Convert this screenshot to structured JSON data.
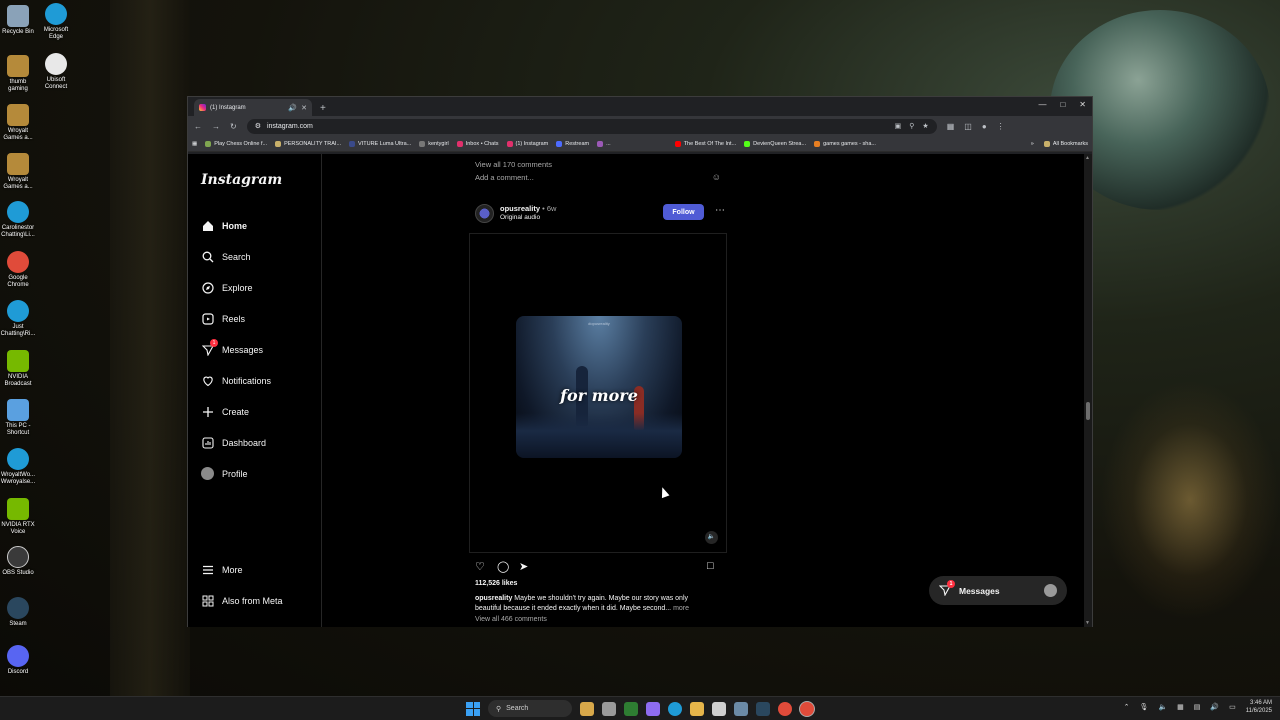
{
  "desktop": {
    "icons": [
      {
        "label": "Recycle Bin",
        "color": "#8aa2b8"
      },
      {
        "label": "Microsoft Edge",
        "color": "#1f9bd6"
      },
      {
        "label": "thumb gaming",
        "color": "#b58a3a"
      },
      {
        "label": "Ubisoft Connect",
        "color": "#e8e8e8"
      },
      {
        "label": "Wroyalt Games a...",
        "color": "#b58a3a"
      },
      {
        "label": "Wroyalt Games a...",
        "color": "#b58a3a"
      },
      {
        "label": "Carolinestor Chatting\\Li...",
        "color": "#1f9bd6"
      },
      {
        "label": "Google Chrome",
        "color": "#e04b3a"
      },
      {
        "label": "Just Chatting\\Ri...",
        "color": "#1f9bd6"
      },
      {
        "label": "NVIDIA Broadcast",
        "color": "#76b900"
      },
      {
        "label": "This PC - Shortcut",
        "color": "#5aa0e0"
      },
      {
        "label": "WroyaltWo... Wwroyalse...",
        "color": "#1f9bd6"
      },
      {
        "label": "NVIDIA RTX Voice",
        "color": "#76b900"
      },
      {
        "label": "OBS Studio",
        "color": "#3a3a3a"
      },
      {
        "label": "Steam",
        "color": "#2a475e"
      },
      {
        "label": "Discord",
        "color": "#5865f2"
      }
    ]
  },
  "browser": {
    "tab_title": "(1) Instagram",
    "new_tab": "+",
    "url": "instagram.com",
    "bookmarks": [
      {
        "label": "Play Chess Online f...",
        "color": "#7fa650"
      },
      {
        "label": "PERSONALITY TRAI...",
        "color": "#c8b06a"
      },
      {
        "label": "VITURE Luma Ultra...",
        "color": "#3a4a8a"
      },
      {
        "label": "kentygirl",
        "color": "#777777"
      },
      {
        "label": "Inbox • Chats",
        "color": "#e1306c"
      },
      {
        "label": "(1) Instagram",
        "color": "#e1306c"
      },
      {
        "label": "Restream",
        "color": "#4d6bfe"
      },
      {
        "label": "...",
        "color": "#9b59b6"
      },
      {
        "label": "The Best Of The Int...",
        "color": "#ff0000"
      },
      {
        "label": "DevienQueen Strea...",
        "color": "#53fc18"
      },
      {
        "label": "games games - sha...",
        "color": "#e67e22"
      }
    ],
    "all_bookmarks": "All Bookmarks"
  },
  "instagram": {
    "logo": "Instagram",
    "nav": [
      {
        "label": "Home",
        "icon": "home-icon"
      },
      {
        "label": "Search",
        "icon": "search-icon"
      },
      {
        "label": "Explore",
        "icon": "explore-icon"
      },
      {
        "label": "Reels",
        "icon": "reels-icon"
      },
      {
        "label": "Messages",
        "icon": "messages-icon",
        "badge": "1"
      },
      {
        "label": "Notifications",
        "icon": "heart-icon"
      },
      {
        "label": "Create",
        "icon": "plus-icon"
      },
      {
        "label": "Dashboard",
        "icon": "dashboard-icon"
      },
      {
        "label": "Profile",
        "icon": "avatar"
      }
    ],
    "more": "More",
    "also_from_meta": "Also from Meta",
    "prev_post": {
      "view_comments": "View all 170 comments",
      "add_comment": "Add a comment..."
    },
    "post": {
      "username": "opusreality",
      "time": "• 6w",
      "audio": "Original audio",
      "follow": "Follow",
      "media_text": "for more",
      "media_watermark": "#opusreality",
      "likes": "112,526 likes",
      "caption_user": "opusreality",
      "caption_text": " Maybe we shouldn't try again. Maybe our story was only beautiful because it ended exactly when it did. Maybe second...",
      "caption_more": " more",
      "view_comments": "View all 466 comments"
    },
    "messages_pill": {
      "label": "Messages",
      "badge": "1"
    }
  },
  "taskbar": {
    "search_label": "Search",
    "time": "3:46 AM",
    "date": "11/6/2025"
  }
}
